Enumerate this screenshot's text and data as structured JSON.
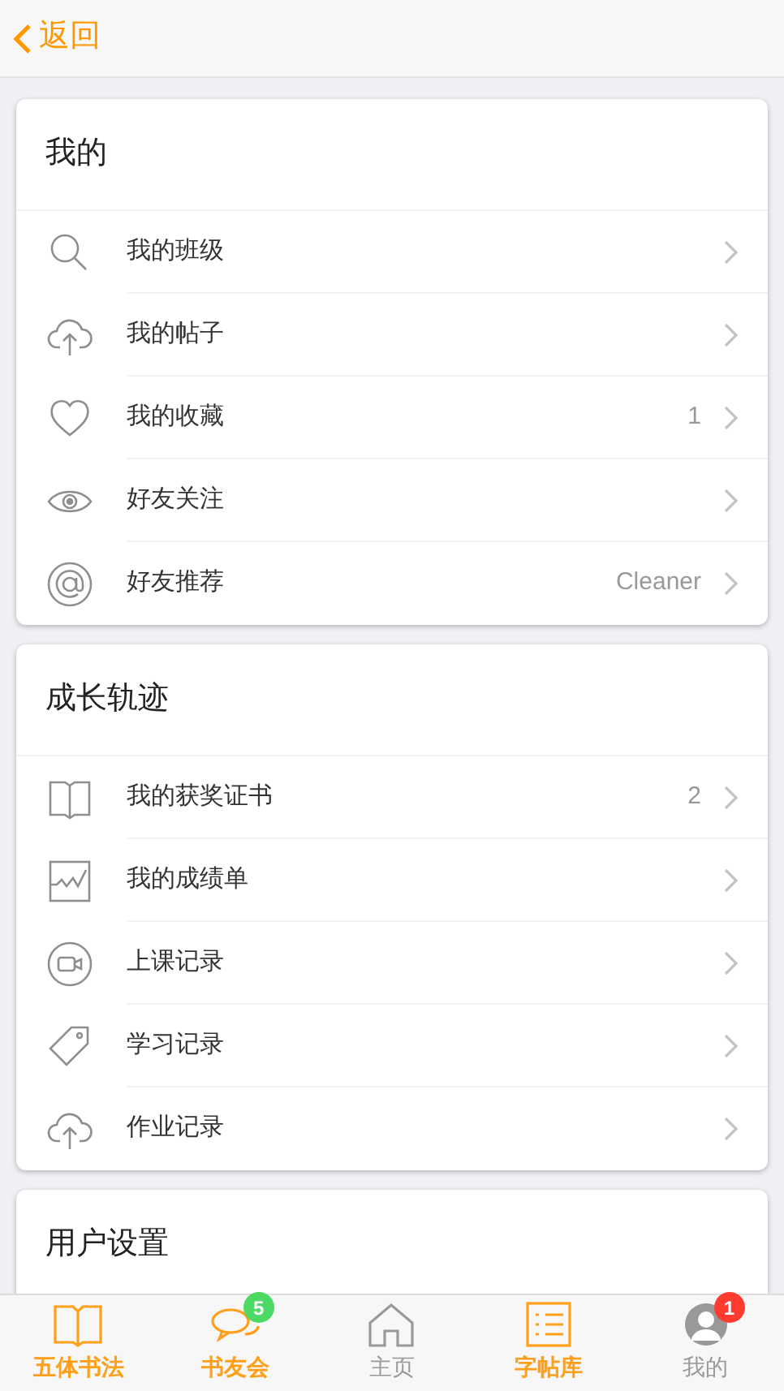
{
  "header": {
    "back_label": "返回"
  },
  "sections": [
    {
      "title": "我的",
      "items": [
        {
          "label": "我的班级"
        },
        {
          "label": "我的帖子"
        },
        {
          "label": "我的收藏",
          "value": "1"
        },
        {
          "label": "好友关注"
        },
        {
          "label": "好友推荐",
          "value": "Cleaner"
        }
      ]
    },
    {
      "title": "成长轨迹",
      "items": [
        {
          "label": "我的获奖证书",
          "value": "2"
        },
        {
          "label": "我的成绩单"
        },
        {
          "label": "上课记录"
        },
        {
          "label": "学习记录"
        },
        {
          "label": "作业记录"
        }
      ]
    },
    {
      "title": "用户设置"
    }
  ],
  "tab_bar": [
    {
      "label": "五体书法",
      "highlighted": true
    },
    {
      "label": "书友会",
      "highlighted": true,
      "badge": "5",
      "color": "#4cd964"
    },
    {
      "label": "主页",
      "highlighted": false
    },
    {
      "label": "字帖库",
      "highlighted": true
    },
    {
      "label": "我的",
      "highlighted": false,
      "badge": "1",
      "color": "#ff3b30"
    }
  ]
}
